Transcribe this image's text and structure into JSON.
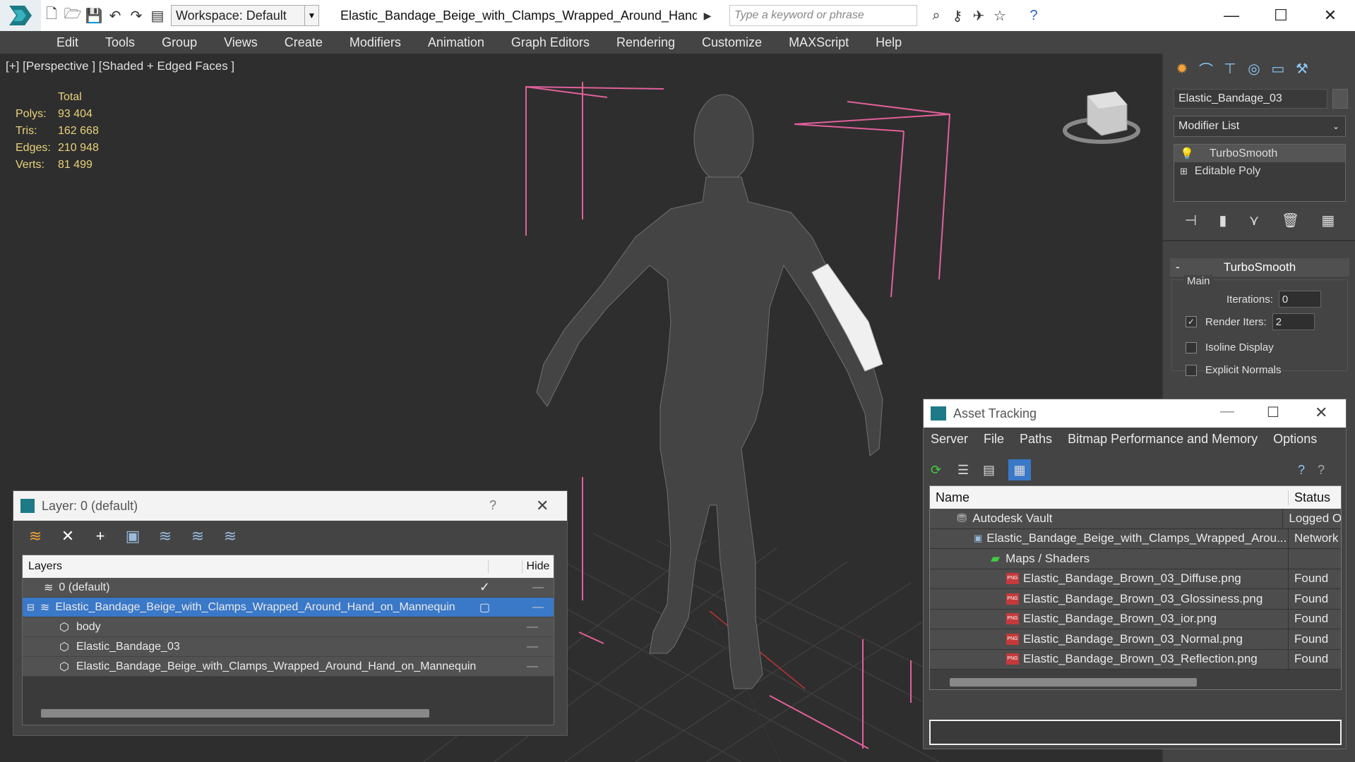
{
  "titlebar": {
    "workspace": "Workspace: Default",
    "doc_title": "Elastic_Bandage_Beige_with_Clamps_Wrapped_Around_Hand...",
    "search_placeholder": "Type a keyword or phrase"
  },
  "menu": [
    "Edit",
    "Tools",
    "Group",
    "Views",
    "Create",
    "Modifiers",
    "Animation",
    "Graph Editors",
    "Rendering",
    "Customize",
    "MAXScript",
    "Help"
  ],
  "viewport": {
    "label": "[+] [Perspective ] [Shaded + Edged Faces ]",
    "stats": {
      "header": "Total",
      "rows": [
        {
          "label": "Polys:",
          "value": "93 404"
        },
        {
          "label": "Tris:",
          "value": "162 668"
        },
        {
          "label": "Edges:",
          "value": "210 948"
        },
        {
          "label": "Verts:",
          "value": "81 499"
        }
      ]
    }
  },
  "command_panel": {
    "object_name": "Elastic_Bandage_03",
    "modifier_list": "Modifier List",
    "stack": [
      "TurboSmooth",
      "Editable Poly"
    ],
    "turbosmooth": {
      "title": "TurboSmooth",
      "group": "Main",
      "iterations_label": "Iterations:",
      "iterations_value": "0",
      "render_iters_label": "Render Iters:",
      "render_iters_value": "2",
      "isoline_label": "Isoline Display",
      "explicit_label": "Explicit Normals"
    }
  },
  "layer_dialog": {
    "title": "Layer: 0 (default)",
    "help": "?",
    "col_layers": "Layers",
    "col_hide": "Hide",
    "rows": [
      {
        "name": "0 (default)",
        "indent": 0
      },
      {
        "name": "Elastic_Bandage_Beige_with_Clamps_Wrapped_Around_Hand_on_Mannequin",
        "indent": 0
      },
      {
        "name": "body",
        "indent": 1
      },
      {
        "name": "Elastic_Bandage_03",
        "indent": 1
      },
      {
        "name": "Elastic_Bandage_Beige_with_Clamps_Wrapped_Around_Hand_on_Mannequin",
        "indent": 1
      }
    ]
  },
  "asset_tracking": {
    "title": "Asset Tracking",
    "menu": [
      "Server",
      "File",
      "Paths",
      "Bitmap Performance and Memory",
      "Options"
    ],
    "col_name": "Name",
    "col_status": "Status",
    "rows": [
      {
        "name": "Autodesk Vault",
        "status": "Logged O"
      },
      {
        "name": "Elastic_Bandage_Beige_with_Clamps_Wrapped_Arou...",
        "status": "Network"
      },
      {
        "name": "Maps / Shaders",
        "status": ""
      },
      {
        "name": "Elastic_Bandage_Brown_03_Diffuse.png",
        "status": "Found"
      },
      {
        "name": "Elastic_Bandage_Brown_03_Glossiness.png",
        "status": "Found"
      },
      {
        "name": "Elastic_Bandage_Brown_03_ior.png",
        "status": "Found"
      },
      {
        "name": "Elastic_Bandage_Brown_03_Normal.png",
        "status": "Found"
      },
      {
        "name": "Elastic_Bandage_Brown_03_Reflection.png",
        "status": "Found"
      }
    ]
  }
}
